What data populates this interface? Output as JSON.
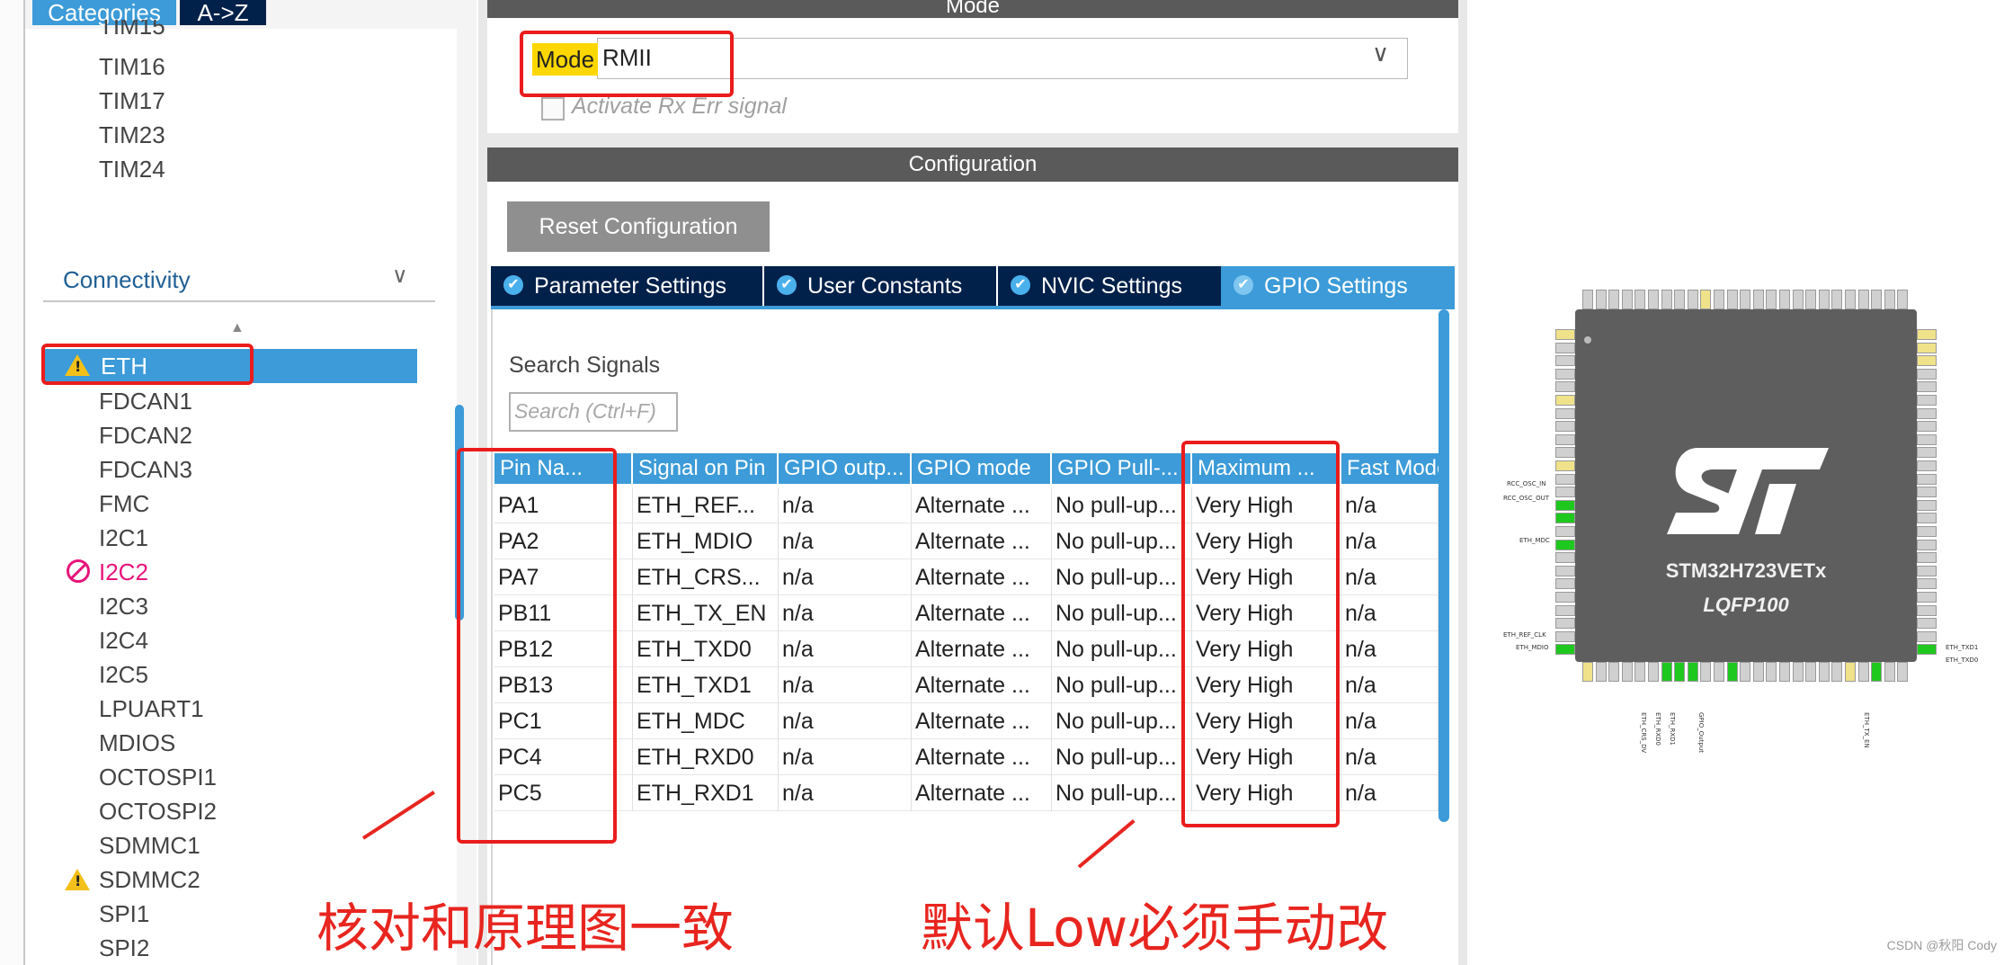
{
  "left": {
    "tabs": [
      "Categories",
      "A->Z"
    ],
    "timers": [
      "TIM15",
      "TIM16",
      "TIM17",
      "TIM23",
      "TIM24"
    ],
    "category": "Connectivity",
    "items": [
      {
        "label": "ETH",
        "status": "warning",
        "selected": true
      },
      {
        "label": "FDCAN1"
      },
      {
        "label": "FDCAN2"
      },
      {
        "label": "FDCAN3"
      },
      {
        "label": "FMC"
      },
      {
        "label": "I2C1"
      },
      {
        "label": "I2C2",
        "status": "disabled"
      },
      {
        "label": "I2C3"
      },
      {
        "label": "I2C4"
      },
      {
        "label": "I2C5"
      },
      {
        "label": "LPUART1"
      },
      {
        "label": "MDIOS"
      },
      {
        "label": "OCTOSPI1"
      },
      {
        "label": "OCTOSPI2"
      },
      {
        "label": "SDMMC1"
      },
      {
        "label": "SDMMC2",
        "status": "warning"
      },
      {
        "label": "SPI1"
      },
      {
        "label": "SPI2"
      }
    ]
  },
  "mode": {
    "header": "Mode",
    "label": "Mode",
    "value": "RMII",
    "rx_err_label": "Activate Rx Err signal"
  },
  "config": {
    "header": "Configuration",
    "reset_label": "Reset Configuration",
    "tabs": [
      "Parameter Settings",
      "User Constants",
      "NVIC Settings",
      "GPIO Settings"
    ],
    "search_label": "Search Signals",
    "search_placeholder": "Search (Ctrl+F)",
    "columns": [
      "Pin Na...",
      "Signal on Pin",
      "GPIO outp...",
      "GPIO mode",
      "GPIO Pull-...",
      "Maximum ...",
      "Fast Mode"
    ],
    "rows": [
      [
        "PA1",
        "ETH_REF...",
        "n/a",
        "Alternate ...",
        "No pull-up...",
        "Very High",
        "n/a"
      ],
      [
        "PA2",
        "ETH_MDIO",
        "n/a",
        "Alternate ...",
        "No pull-up...",
        "Very High",
        "n/a"
      ],
      [
        "PA7",
        "ETH_CRS...",
        "n/a",
        "Alternate ...",
        "No pull-up...",
        "Very High",
        "n/a"
      ],
      [
        "PB11",
        "ETH_TX_EN",
        "n/a",
        "Alternate ...",
        "No pull-up...",
        "Very High",
        "n/a"
      ],
      [
        "PB12",
        "ETH_TXD0",
        "n/a",
        "Alternate ...",
        "No pull-up...",
        "Very High",
        "n/a"
      ],
      [
        "PB13",
        "ETH_TXD1",
        "n/a",
        "Alternate ...",
        "No pull-up...",
        "Very High",
        "n/a"
      ],
      [
        "PC1",
        "ETH_MDC",
        "n/a",
        "Alternate ...",
        "No pull-up...",
        "Very High",
        "n/a"
      ],
      [
        "PC4",
        "ETH_RXD0",
        "n/a",
        "Alternate ...",
        "No pull-up...",
        "Very High",
        "n/a"
      ],
      [
        "PC5",
        "ETH_RXD1",
        "n/a",
        "Alternate ...",
        "No pull-up...",
        "Very High",
        "n/a"
      ]
    ]
  },
  "chip": {
    "name": "STM32H723VETx",
    "package": "LQFP100",
    "left_labels": [
      "RCC_OSC_IN",
      "RCC_OSC_OUT",
      "ETH_MDC",
      "ETH_REF_CLK",
      "ETH_MDIO"
    ],
    "right_labels": [
      "ETH_TXD1",
      "ETH_TXD0"
    ],
    "bottom_labels": [
      "ETH_CRS_DV",
      "ETH_RXD0",
      "ETH_RXD1",
      "GPIO_Output",
      "ETH_TX_EN"
    ]
  },
  "annotations": {
    "note_left": "核对和原理图一致",
    "note_right": "默认Low必须手动改"
  },
  "watermark": "CSDN @秋阳 Cody",
  "colors": {
    "accent_blue": "#3c9bd8",
    "dark_navy": "#02214a",
    "mode_highlight": "#ffd700",
    "annotation_red": "#e8251f",
    "pin_green": "#1ec81e"
  }
}
